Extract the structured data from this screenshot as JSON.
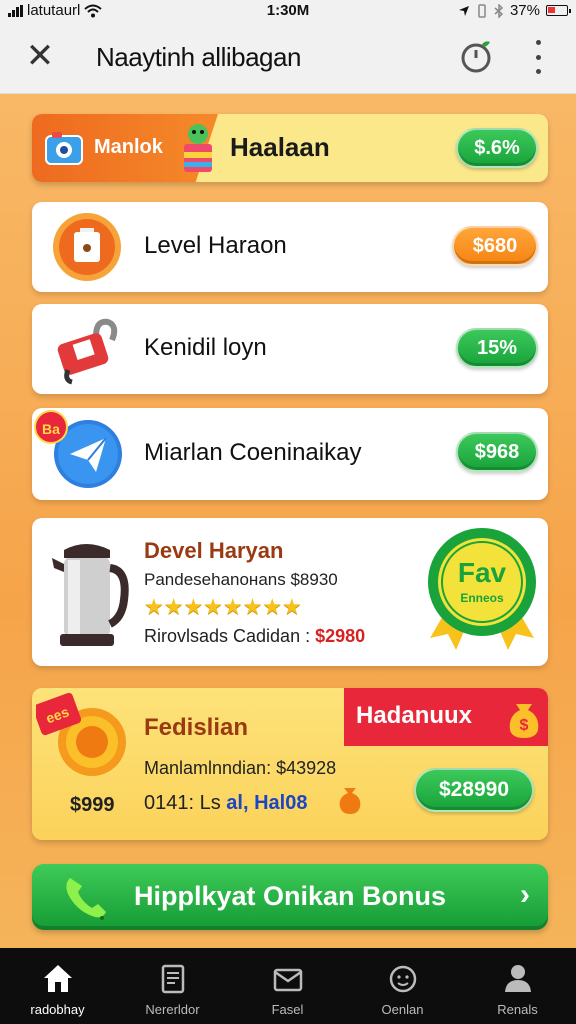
{
  "status": {
    "carrier": "latutaurl",
    "time": "1:30M",
    "battery": "37%"
  },
  "header": {
    "title": "Naaytinh allibagan",
    "close_glyph": "✕"
  },
  "banner": {
    "brand": "Manlok",
    "name": "Haalaan",
    "price": "$.6%"
  },
  "items": [
    {
      "label": "Level Haraon",
      "price": "$680",
      "color": "orange",
      "icon": "box-coin-icon"
    },
    {
      "label": "Kenidil loyn",
      "price": "15%",
      "color": "green",
      "icon": "padlock-icon"
    },
    {
      "label": "Miarlan Coeninaikay",
      "price": "$968",
      "color": "green",
      "icon": "send-arrow-icon"
    }
  ],
  "item_badge": "Ba",
  "product": {
    "title": "Devel Haryan",
    "desc": "Pandesehanoнans $8930",
    "stars": "★★★★★★★★",
    "line_label": "Rirovlsads Cadidan : ",
    "line_price": "$2980",
    "badge_top": "Fav",
    "badge_bottom": "Enneos"
  },
  "promo": {
    "tag_coin": "ees",
    "title": "Fedislian",
    "red_tag": "Hadanuux",
    "desc": "Manlamlnndian: $43928",
    "left_price": "$999",
    "code_prefix": "0141: Ls",
    "code_blue": "al, Hal08",
    "price": "$28990"
  },
  "cta": {
    "label": "Hipplkyat Onikan Bonus",
    "chevron": "›"
  },
  "tabs": [
    {
      "label": "radobhay",
      "icon": "home-icon",
      "active": true
    },
    {
      "label": "Nererldor",
      "icon": "document-icon"
    },
    {
      "label": "Fasel",
      "icon": "envelope-icon"
    },
    {
      "label": "Oenlan",
      "icon": "face-icon"
    },
    {
      "label": "Renals",
      "icon": "person-icon"
    }
  ],
  "colors": {
    "accent_orange": "#f58412",
    "accent_green": "#18a33a",
    "red": "#e8283a",
    "banner_yellow": "#fbe88a"
  }
}
